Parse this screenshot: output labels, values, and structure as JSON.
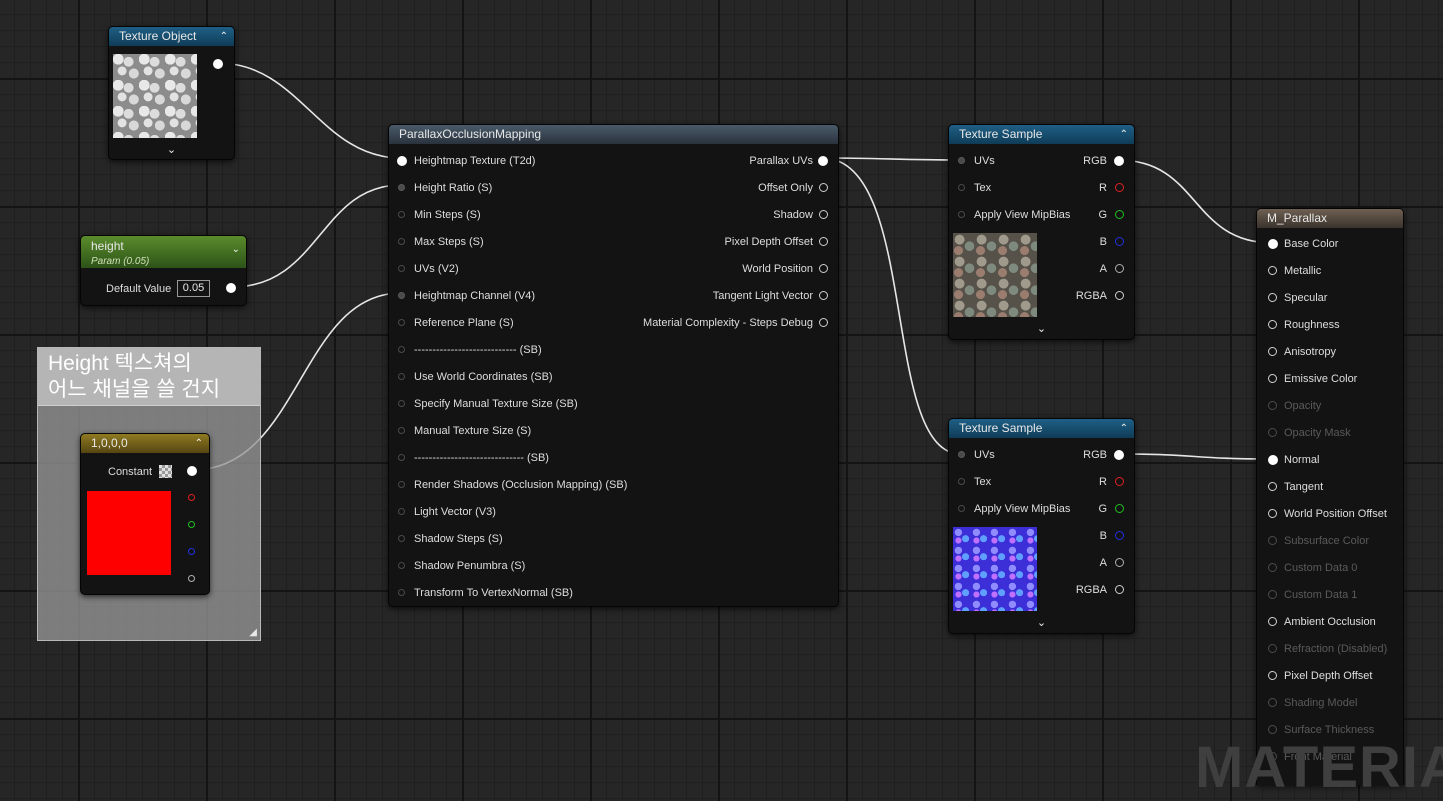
{
  "texture_object": {
    "title": "Texture Object"
  },
  "height_param": {
    "title": "height",
    "subtitle": "Param (0.05)",
    "default_label": "Default Value",
    "default_value": "0.05"
  },
  "comment": {
    "line1": "Height 텍스쳐의",
    "line2": "어느 채널을 쓸 건지"
  },
  "constant_node": {
    "title": "1,0,0,0",
    "output_label": "Constant",
    "color": "#ff0000"
  },
  "pom": {
    "title": "ParallaxOcclusionMapping",
    "inputs": [
      "Heightmap Texture (T2d)",
      "Height Ratio (S)",
      "Min Steps (S)",
      "Max Steps (S)",
      "UVs (V2)",
      "Heightmap Channel (V4)",
      "Reference Plane (S)",
      "---------------------------- (SB)",
      "Use World Coordinates (SB)",
      "Specify Manual Texture Size (SB)",
      "Manual Texture Size (S)",
      "------------------------------ (SB)",
      "Render Shadows (Occlusion Mapping) (SB)",
      "Light Vector (V3)",
      "Shadow Steps (S)",
      "Shadow Penumbra (S)",
      "Transform To VertexNormal (SB)"
    ],
    "outputs": [
      "Parallax UVs",
      "Offset Only",
      "Shadow",
      "Pixel Depth Offset",
      "World Position",
      "Tangent Light Vector",
      "Material Complexity - Steps Debug"
    ]
  },
  "texture_sample_1": {
    "title": "Texture Sample",
    "inputs": [
      "UVs",
      "Tex",
      "Apply View MipBias"
    ],
    "outputs": [
      "RGB",
      "R",
      "G",
      "B",
      "A",
      "RGBA"
    ]
  },
  "texture_sample_2": {
    "title": "Texture Sample",
    "inputs": [
      "UVs",
      "Tex",
      "Apply View MipBias"
    ],
    "outputs": [
      "RGB",
      "R",
      "G",
      "B",
      "A",
      "RGBA"
    ]
  },
  "material": {
    "title": "M_Parallax",
    "pins": [
      {
        "label": "Base Color",
        "enabled": true
      },
      {
        "label": "Metallic",
        "enabled": true
      },
      {
        "label": "Specular",
        "enabled": true
      },
      {
        "label": "Roughness",
        "enabled": true
      },
      {
        "label": "Anisotropy",
        "enabled": true
      },
      {
        "label": "Emissive Color",
        "enabled": true
      },
      {
        "label": "Opacity",
        "enabled": false
      },
      {
        "label": "Opacity Mask",
        "enabled": false
      },
      {
        "label": "Normal",
        "enabled": true
      },
      {
        "label": "Tangent",
        "enabled": true
      },
      {
        "label": "World Position Offset",
        "enabled": true
      },
      {
        "label": "Subsurface Color",
        "enabled": false
      },
      {
        "label": "Custom Data 0",
        "enabled": false
      },
      {
        "label": "Custom Data 1",
        "enabled": false
      },
      {
        "label": "Ambient Occlusion",
        "enabled": true
      },
      {
        "label": "Refraction (Disabled)",
        "enabled": false
      },
      {
        "label": "Pixel Depth Offset",
        "enabled": true
      },
      {
        "label": "Shading Model",
        "enabled": false
      },
      {
        "label": "Surface Thickness",
        "enabled": false
      },
      {
        "label": "Front Material",
        "enabled": false
      }
    ]
  },
  "watermark": "MATERIAL",
  "colors": {
    "wire": "#e6e6e6",
    "pin_red": "#e02020",
    "pin_green": "#20c020",
    "pin_blue": "#2030e0"
  }
}
